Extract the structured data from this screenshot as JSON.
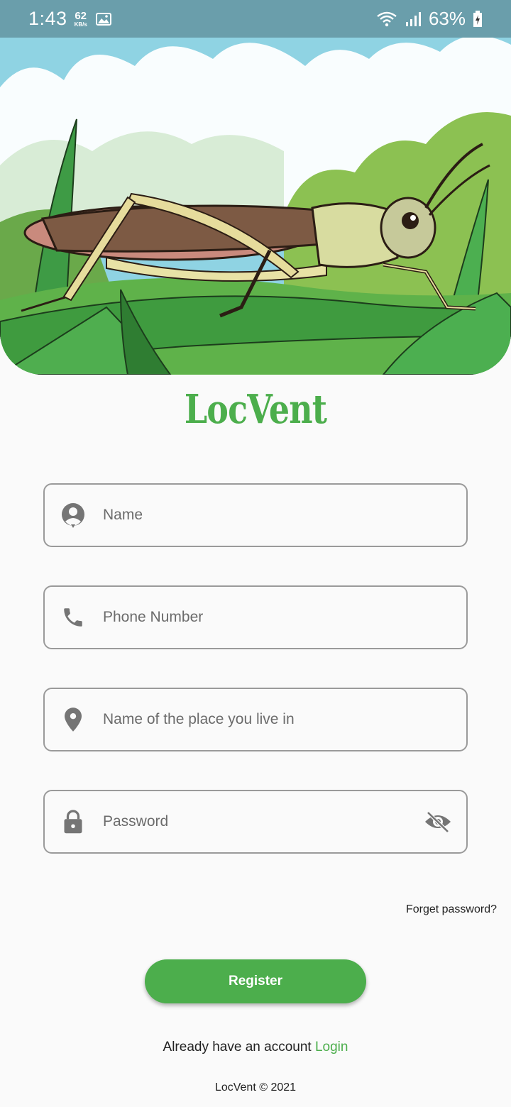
{
  "status_bar": {
    "time": "1:43",
    "speed_value": "62",
    "speed_unit": "KB/s",
    "battery_percent": "63%",
    "icons": [
      "gallery-icon",
      "wifi-icon",
      "signal-icon",
      "battery-icon"
    ]
  },
  "hero": {
    "illustration": "grasshopper-on-leaves"
  },
  "logo": {
    "text": "LocVent",
    "color": "#4cae4c"
  },
  "form": {
    "name": {
      "placeholder": "Name",
      "icon": "person-icon"
    },
    "phone": {
      "placeholder": "Phone Number",
      "icon": "phone-icon"
    },
    "place": {
      "placeholder": "Name of the place you live in",
      "icon": "location-pin-icon"
    },
    "password": {
      "placeholder": "Password",
      "icon": "lock-icon",
      "toggle_icon": "eye-off-icon"
    },
    "forgot_label": "Forget password?",
    "register_label": "Register"
  },
  "account": {
    "prompt": "Already have an account",
    "login_label": "Login"
  },
  "footer": {
    "copyright": "LocVent © 2021"
  },
  "colors": {
    "accent": "#4cae4c",
    "status_bar": "#6a9eab",
    "field_border": "#9a9a9a",
    "icon_gray": "#757575"
  }
}
